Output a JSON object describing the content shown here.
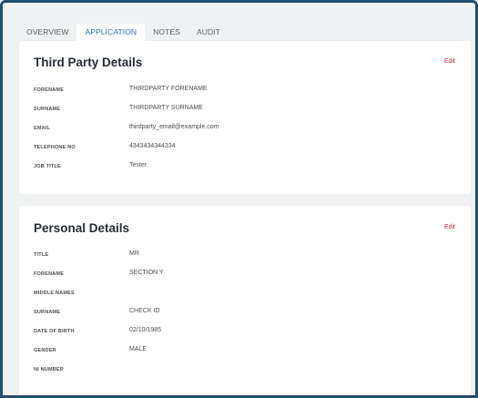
{
  "tabs": [
    "OVERVIEW",
    "APPLICATION",
    "NOTES",
    "AUDIT"
  ],
  "active_tab": "APPLICATION",
  "third_party": {
    "title": "Third Party Details",
    "edit_label": "Edit",
    "fields": [
      {
        "label": "FORENAME",
        "value": "THIRDPARTY FORENAME"
      },
      {
        "label": "SURNAME",
        "value": "THIRDPARTY SURNAME"
      },
      {
        "label": "EMAIL",
        "value": "thirdparty_email@example.com"
      },
      {
        "label": "TELEPHONE NO",
        "value": "4343434344334"
      },
      {
        "label": "JOB TITLE",
        "value": "Tester"
      }
    ]
  },
  "personal": {
    "title": "Personal Details",
    "edit_label": "Edit",
    "fields": [
      {
        "label": "TITLE",
        "value": "MR"
      },
      {
        "label": "FORENAME",
        "value": "SECTION Y"
      },
      {
        "label": "MIDDLE NAMES",
        "value": ""
      },
      {
        "label": "SURNAME",
        "value": "CHECK ID"
      },
      {
        "label": "DATE OF BIRTH",
        "value": "02/10/1985"
      },
      {
        "label": "GENDER",
        "value": "MALE"
      },
      {
        "label": "NI NUMBER",
        "value": ""
      }
    ]
  },
  "colors": {
    "frame_border": "#1e4f6e",
    "background": "#f0f1f3",
    "active_tab": "#2e73b8",
    "edit_link": "#c4203c"
  }
}
